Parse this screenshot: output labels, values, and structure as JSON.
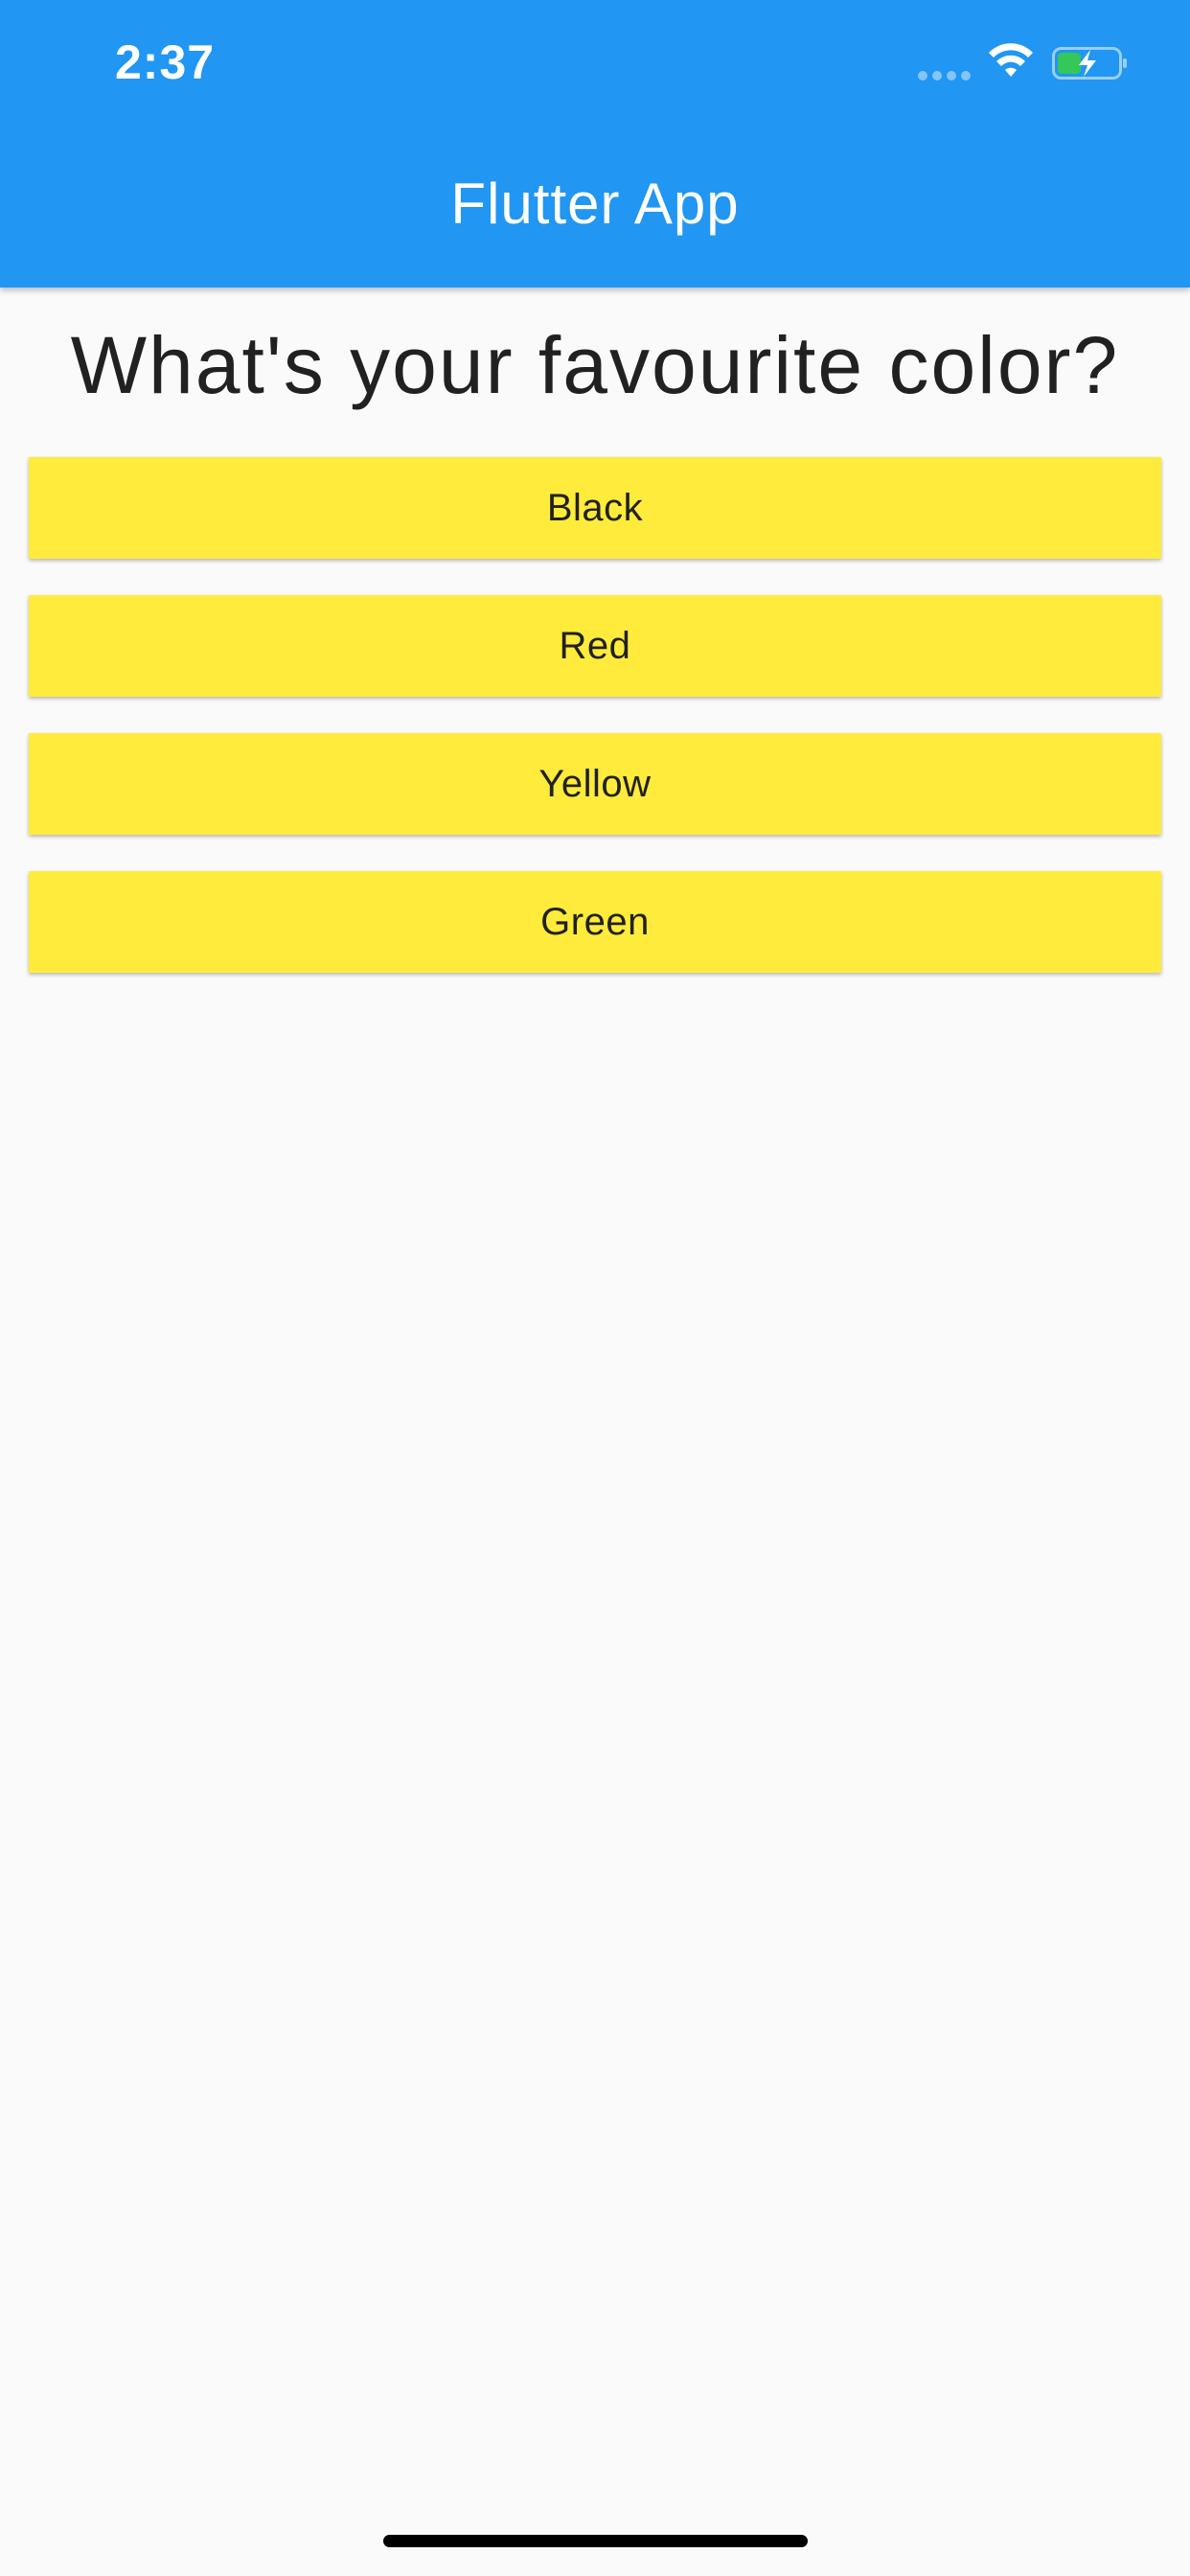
{
  "status_bar": {
    "time": "2:37",
    "signal_icon": "signal-dots-icon",
    "wifi_icon": "wifi-icon",
    "battery_icon": "battery-charging-icon"
  },
  "app_bar": {
    "title": "Flutter App",
    "background_color": "#2196f3"
  },
  "quiz": {
    "question": "What's your favourite color?",
    "answers": [
      "Black",
      "Red",
      "Yellow",
      "Green"
    ],
    "button_color": "#ffeb3b"
  },
  "colors": {
    "battery_fill": "#34c759",
    "page_background": "#fafafa"
  }
}
